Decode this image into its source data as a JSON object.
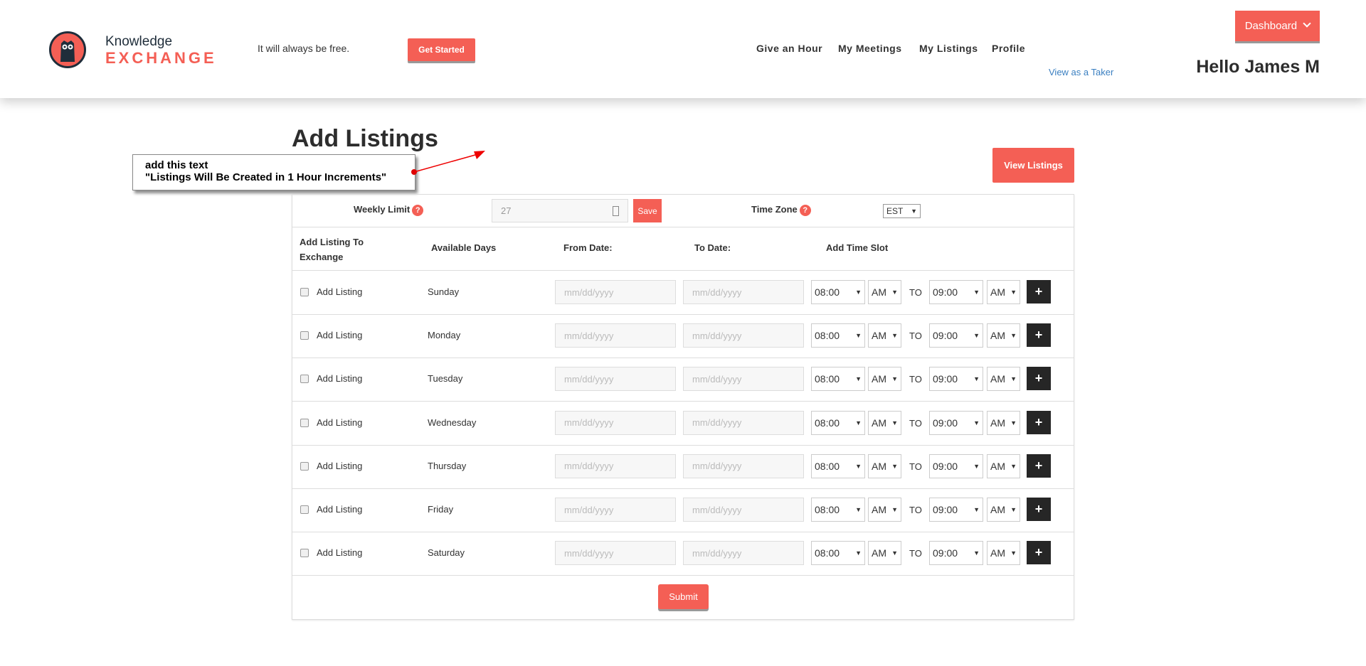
{
  "header": {
    "logo_top": "Knowledge",
    "logo_bottom": "EXCHANGE",
    "tagline": "It will always be free.",
    "get_started": "Get Started",
    "nav": [
      "Give an Hour",
      "My Meetings",
      "My Listings",
      "Profile"
    ],
    "view_as_taker": "View as a Taker",
    "dashboard": "Dashboard",
    "greeting": "Hello James M"
  },
  "page": {
    "title": "Add Listings",
    "view_listings": "View Listings"
  },
  "annotation": {
    "line1": "add this text",
    "line2": "\"Listings Will Be Created in 1 Hour Increments\""
  },
  "settings": {
    "weekly_limit_label": "Weekly Limit",
    "help": "?",
    "weekly_limit_value": "27",
    "save": "Save",
    "time_zone_label": "Time Zone",
    "time_zone": "EST"
  },
  "columns": [
    "Add Listing To Exchange",
    "Available Days",
    "From Date:",
    "To Date:",
    "Add Time Slot"
  ],
  "rows": [
    {
      "label": "Add Listing",
      "day": "Sunday",
      "from_placeholder": "mm/dd/yyyy",
      "to_placeholder": "mm/dd/yyyy",
      "start": "08:00",
      "start_ampm": "AM",
      "sep": "TO",
      "end": "09:00",
      "end_ampm": "AM",
      "add": "+"
    },
    {
      "label": "Add Listing",
      "day": "Monday",
      "from_placeholder": "mm/dd/yyyy",
      "to_placeholder": "mm/dd/yyyy",
      "start": "08:00",
      "start_ampm": "AM",
      "sep": "TO",
      "end": "09:00",
      "end_ampm": "AM",
      "add": "+"
    },
    {
      "label": "Add Listing",
      "day": "Tuesday",
      "from_placeholder": "mm/dd/yyyy",
      "to_placeholder": "mm/dd/yyyy",
      "start": "08:00",
      "start_ampm": "AM",
      "sep": "TO",
      "end": "09:00",
      "end_ampm": "AM",
      "add": "+"
    },
    {
      "label": "Add Listing",
      "day": "Wednesday",
      "from_placeholder": "mm/dd/yyyy",
      "to_placeholder": "mm/dd/yyyy",
      "start": "08:00",
      "start_ampm": "AM",
      "sep": "TO",
      "end": "09:00",
      "end_ampm": "AM",
      "add": "+"
    },
    {
      "label": "Add Listing",
      "day": "Thursday",
      "from_placeholder": "mm/dd/yyyy",
      "to_placeholder": "mm/dd/yyyy",
      "start": "08:00",
      "start_ampm": "AM",
      "sep": "TO",
      "end": "09:00",
      "end_ampm": "AM",
      "add": "+"
    },
    {
      "label": "Add Listing",
      "day": "Friday",
      "from_placeholder": "mm/dd/yyyy",
      "to_placeholder": "mm/dd/yyyy",
      "start": "08:00",
      "start_ampm": "AM",
      "sep": "TO",
      "end": "09:00",
      "end_ampm": "AM",
      "add": "+"
    },
    {
      "label": "Add Listing",
      "day": "Saturday",
      "from_placeholder": "mm/dd/yyyy",
      "to_placeholder": "mm/dd/yyyy",
      "start": "08:00",
      "start_ampm": "AM",
      "sep": "TO",
      "end": "09:00",
      "end_ampm": "AM",
      "add": "+"
    }
  ],
  "submit": "Submit"
}
